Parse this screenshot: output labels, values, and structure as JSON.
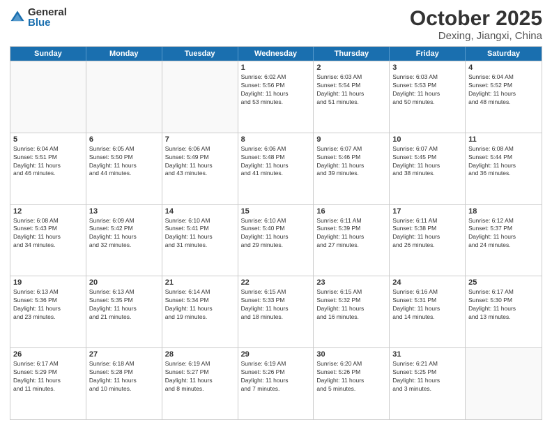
{
  "header": {
    "logo": {
      "general": "General",
      "blue": "Blue"
    },
    "month": "October 2025",
    "location": "Dexing, Jiangxi, China"
  },
  "weekdays": [
    "Sunday",
    "Monday",
    "Tuesday",
    "Wednesday",
    "Thursday",
    "Friday",
    "Saturday"
  ],
  "weeks": [
    [
      {
        "day": "",
        "info": ""
      },
      {
        "day": "",
        "info": ""
      },
      {
        "day": "",
        "info": ""
      },
      {
        "day": "1",
        "info": "Sunrise: 6:02 AM\nSunset: 5:56 PM\nDaylight: 11 hours\nand 53 minutes."
      },
      {
        "day": "2",
        "info": "Sunrise: 6:03 AM\nSunset: 5:54 PM\nDaylight: 11 hours\nand 51 minutes."
      },
      {
        "day": "3",
        "info": "Sunrise: 6:03 AM\nSunset: 5:53 PM\nDaylight: 11 hours\nand 50 minutes."
      },
      {
        "day": "4",
        "info": "Sunrise: 6:04 AM\nSunset: 5:52 PM\nDaylight: 11 hours\nand 48 minutes."
      }
    ],
    [
      {
        "day": "5",
        "info": "Sunrise: 6:04 AM\nSunset: 5:51 PM\nDaylight: 11 hours\nand 46 minutes."
      },
      {
        "day": "6",
        "info": "Sunrise: 6:05 AM\nSunset: 5:50 PM\nDaylight: 11 hours\nand 44 minutes."
      },
      {
        "day": "7",
        "info": "Sunrise: 6:06 AM\nSunset: 5:49 PM\nDaylight: 11 hours\nand 43 minutes."
      },
      {
        "day": "8",
        "info": "Sunrise: 6:06 AM\nSunset: 5:48 PM\nDaylight: 11 hours\nand 41 minutes."
      },
      {
        "day": "9",
        "info": "Sunrise: 6:07 AM\nSunset: 5:46 PM\nDaylight: 11 hours\nand 39 minutes."
      },
      {
        "day": "10",
        "info": "Sunrise: 6:07 AM\nSunset: 5:45 PM\nDaylight: 11 hours\nand 38 minutes."
      },
      {
        "day": "11",
        "info": "Sunrise: 6:08 AM\nSunset: 5:44 PM\nDaylight: 11 hours\nand 36 minutes."
      }
    ],
    [
      {
        "day": "12",
        "info": "Sunrise: 6:08 AM\nSunset: 5:43 PM\nDaylight: 11 hours\nand 34 minutes."
      },
      {
        "day": "13",
        "info": "Sunrise: 6:09 AM\nSunset: 5:42 PM\nDaylight: 11 hours\nand 32 minutes."
      },
      {
        "day": "14",
        "info": "Sunrise: 6:10 AM\nSunset: 5:41 PM\nDaylight: 11 hours\nand 31 minutes."
      },
      {
        "day": "15",
        "info": "Sunrise: 6:10 AM\nSunset: 5:40 PM\nDaylight: 11 hours\nand 29 minutes."
      },
      {
        "day": "16",
        "info": "Sunrise: 6:11 AM\nSunset: 5:39 PM\nDaylight: 11 hours\nand 27 minutes."
      },
      {
        "day": "17",
        "info": "Sunrise: 6:11 AM\nSunset: 5:38 PM\nDaylight: 11 hours\nand 26 minutes."
      },
      {
        "day": "18",
        "info": "Sunrise: 6:12 AM\nSunset: 5:37 PM\nDaylight: 11 hours\nand 24 minutes."
      }
    ],
    [
      {
        "day": "19",
        "info": "Sunrise: 6:13 AM\nSunset: 5:36 PM\nDaylight: 11 hours\nand 23 minutes."
      },
      {
        "day": "20",
        "info": "Sunrise: 6:13 AM\nSunset: 5:35 PM\nDaylight: 11 hours\nand 21 minutes."
      },
      {
        "day": "21",
        "info": "Sunrise: 6:14 AM\nSunset: 5:34 PM\nDaylight: 11 hours\nand 19 minutes."
      },
      {
        "day": "22",
        "info": "Sunrise: 6:15 AM\nSunset: 5:33 PM\nDaylight: 11 hours\nand 18 minutes."
      },
      {
        "day": "23",
        "info": "Sunrise: 6:15 AM\nSunset: 5:32 PM\nDaylight: 11 hours\nand 16 minutes."
      },
      {
        "day": "24",
        "info": "Sunrise: 6:16 AM\nSunset: 5:31 PM\nDaylight: 11 hours\nand 14 minutes."
      },
      {
        "day": "25",
        "info": "Sunrise: 6:17 AM\nSunset: 5:30 PM\nDaylight: 11 hours\nand 13 minutes."
      }
    ],
    [
      {
        "day": "26",
        "info": "Sunrise: 6:17 AM\nSunset: 5:29 PM\nDaylight: 11 hours\nand 11 minutes."
      },
      {
        "day": "27",
        "info": "Sunrise: 6:18 AM\nSunset: 5:28 PM\nDaylight: 11 hours\nand 10 minutes."
      },
      {
        "day": "28",
        "info": "Sunrise: 6:19 AM\nSunset: 5:27 PM\nDaylight: 11 hours\nand 8 minutes."
      },
      {
        "day": "29",
        "info": "Sunrise: 6:19 AM\nSunset: 5:26 PM\nDaylight: 11 hours\nand 7 minutes."
      },
      {
        "day": "30",
        "info": "Sunrise: 6:20 AM\nSunset: 5:26 PM\nDaylight: 11 hours\nand 5 minutes."
      },
      {
        "day": "31",
        "info": "Sunrise: 6:21 AM\nSunset: 5:25 PM\nDaylight: 11 hours\nand 3 minutes."
      },
      {
        "day": "",
        "info": ""
      }
    ]
  ]
}
